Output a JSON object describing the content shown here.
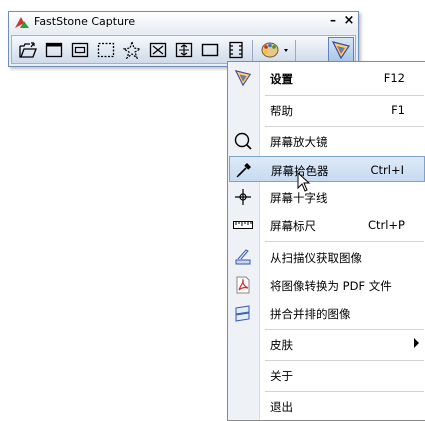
{
  "toolbar": {
    "title": "FastStone Capture",
    "minimize": "–",
    "close": "×",
    "buttons": [
      {
        "icon": "open-file-icon"
      },
      {
        "icon": "capture-active-window-icon"
      },
      {
        "icon": "capture-window-object-icon"
      },
      {
        "icon": "capture-rectangle-icon"
      },
      {
        "icon": "capture-freehand-icon"
      },
      {
        "icon": "capture-fullscreen-icon"
      },
      {
        "icon": "capture-scrolling-window-icon"
      },
      {
        "icon": "capture-fixed-region-icon"
      },
      {
        "icon": "screen-recorder-icon"
      },
      {
        "icon": "output-color-palette-icon"
      },
      {
        "icon": "settings-menu-icon"
      }
    ]
  },
  "menu": {
    "items": [
      {
        "label": "设置",
        "shortcut": "F12",
        "icon": "settings-icon"
      },
      {
        "label": "帮助",
        "shortcut": "F1"
      },
      {
        "label": "屏幕放大镜",
        "icon": "magnifier-icon"
      },
      {
        "label": "屏幕拾色器",
        "shortcut": "Ctrl+I",
        "icon": "color-picker-icon"
      },
      {
        "label": "屏幕十字线",
        "icon": "crosshair-icon"
      },
      {
        "label": "屏幕标尺",
        "shortcut": "Ctrl+P",
        "icon": "ruler-icon"
      },
      {
        "label": "从扫描仪获取图像",
        "icon": "scanner-icon"
      },
      {
        "label": "将图像转换为 PDF 文件",
        "icon": "pdf-icon"
      },
      {
        "label": "拼合并排的图像",
        "icon": "combine-images-icon"
      },
      {
        "label": "皮肤"
      },
      {
        "label": "关于"
      },
      {
        "label": "退出"
      }
    ]
  },
  "colors": {
    "highlight": "#c6daf2",
    "toolbar_border": "#6f8fb8",
    "logo_red": "#d2322d",
    "logo_green": "#2e9d3a"
  }
}
